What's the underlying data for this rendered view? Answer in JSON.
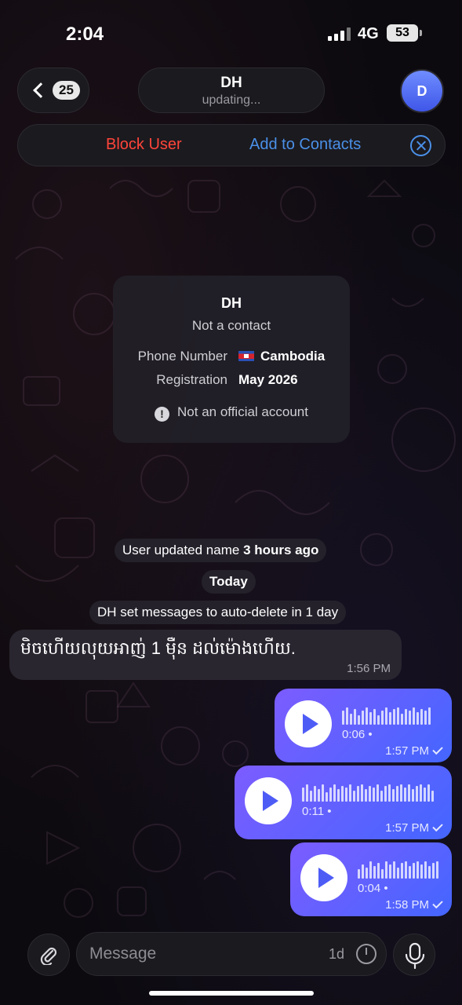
{
  "status_bar": {
    "time": "2:04",
    "network": "4G",
    "battery": "53"
  },
  "header": {
    "back_count": "25",
    "title": "DH",
    "subtitle": "updating...",
    "avatar_initial": "D"
  },
  "action_bar": {
    "block_label": "Block User",
    "add_label": "Add to Contacts"
  },
  "info_card": {
    "name": "DH",
    "status": "Not a contact",
    "phone_label": "Phone Number",
    "phone_value": "Cambodia",
    "registration_label": "Registration",
    "registration_value": "May 2026",
    "official_note": "Not an official account"
  },
  "system_messages": {
    "name_update_prefix": "User updated name",
    "name_update_time": "3 hours ago",
    "date_divider": "Today",
    "auto_delete": "DH set messages to auto-delete in 1 day"
  },
  "messages": [
    {
      "direction": "incoming",
      "type": "text",
      "text": "មិចហើយលុយអាញ់ 1 ម៉ឺន ដល់ម៉ោងហើយ.",
      "time": "1:56 PM"
    },
    {
      "direction": "outgoing",
      "type": "voice",
      "duration": "0:06",
      "time": "1:57 PM"
    },
    {
      "direction": "outgoing",
      "type": "voice",
      "duration": "0:11",
      "time": "1:57 PM"
    },
    {
      "direction": "outgoing",
      "type": "voice",
      "duration": "0:04",
      "time": "1:58 PM"
    }
  ],
  "composer": {
    "placeholder": "Message",
    "timer_label": "1d"
  },
  "colors": {
    "accent_blue": "#4a90e8",
    "danger_red": "#ff453a",
    "bubble_gradient_start": "#7c5cff",
    "bubble_gradient_end": "#4466ff"
  }
}
